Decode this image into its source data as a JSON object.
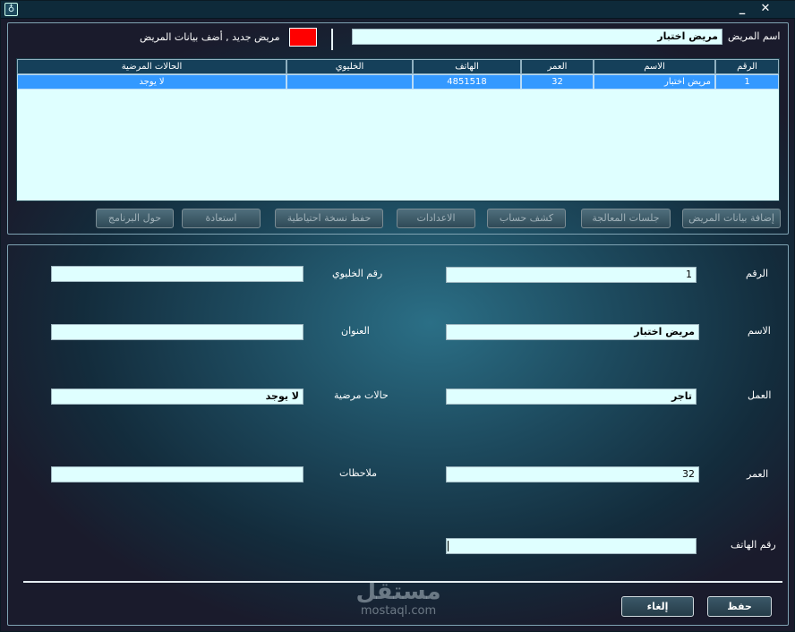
{
  "titlebar": {
    "app_icon": "tooth-icon",
    "minimize_glyph": "_",
    "close_glyph": "✕"
  },
  "search": {
    "label": "اسم المريض",
    "value": "مريض اختبار",
    "new_patient_hint": "مريض جديد , أضف بيانات المريض",
    "indicator_color": "#ff0000"
  },
  "table": {
    "columns": [
      "الرقم",
      "الاسم",
      "العمر",
      "الهاتف",
      "الخليوي",
      "الحالات المرضية"
    ],
    "rows": [
      [
        "1",
        "مريض اختبار",
        "32",
        "4851518",
        "",
        "لا يوجد"
      ]
    ],
    "selected_row_color": "#3399ff"
  },
  "actions": [
    "إضافة بيانات المريض",
    "جلسات المعالجة",
    "كشف حساب",
    "الاعدادات",
    "حفظ نسخة احتياطية",
    "استعادة",
    "حول البرنامج"
  ],
  "form": {
    "number_label": "الرقم",
    "number_value": "1",
    "name_label": "الاسم",
    "name_value": "مريض اختبار",
    "job_label": "العمل",
    "job_value": "تاجر",
    "age_label": "العمر",
    "age_value": "32",
    "phone_label": "رقم الهاتف",
    "phone_value": "",
    "mobile_label": "رقم الخليوي",
    "mobile_value": "",
    "address_label": "العنوان",
    "address_value": "",
    "conditions_label": "حالات مرضية",
    "conditions_value": "لا يوجد",
    "notes_label": "ملاحظات",
    "notes_value": ""
  },
  "footer": {
    "save_label": "حفظ",
    "cancel_label": "إلغاء"
  },
  "watermark": {
    "logo_text": "مستقل",
    "url": "mostaql.com"
  }
}
